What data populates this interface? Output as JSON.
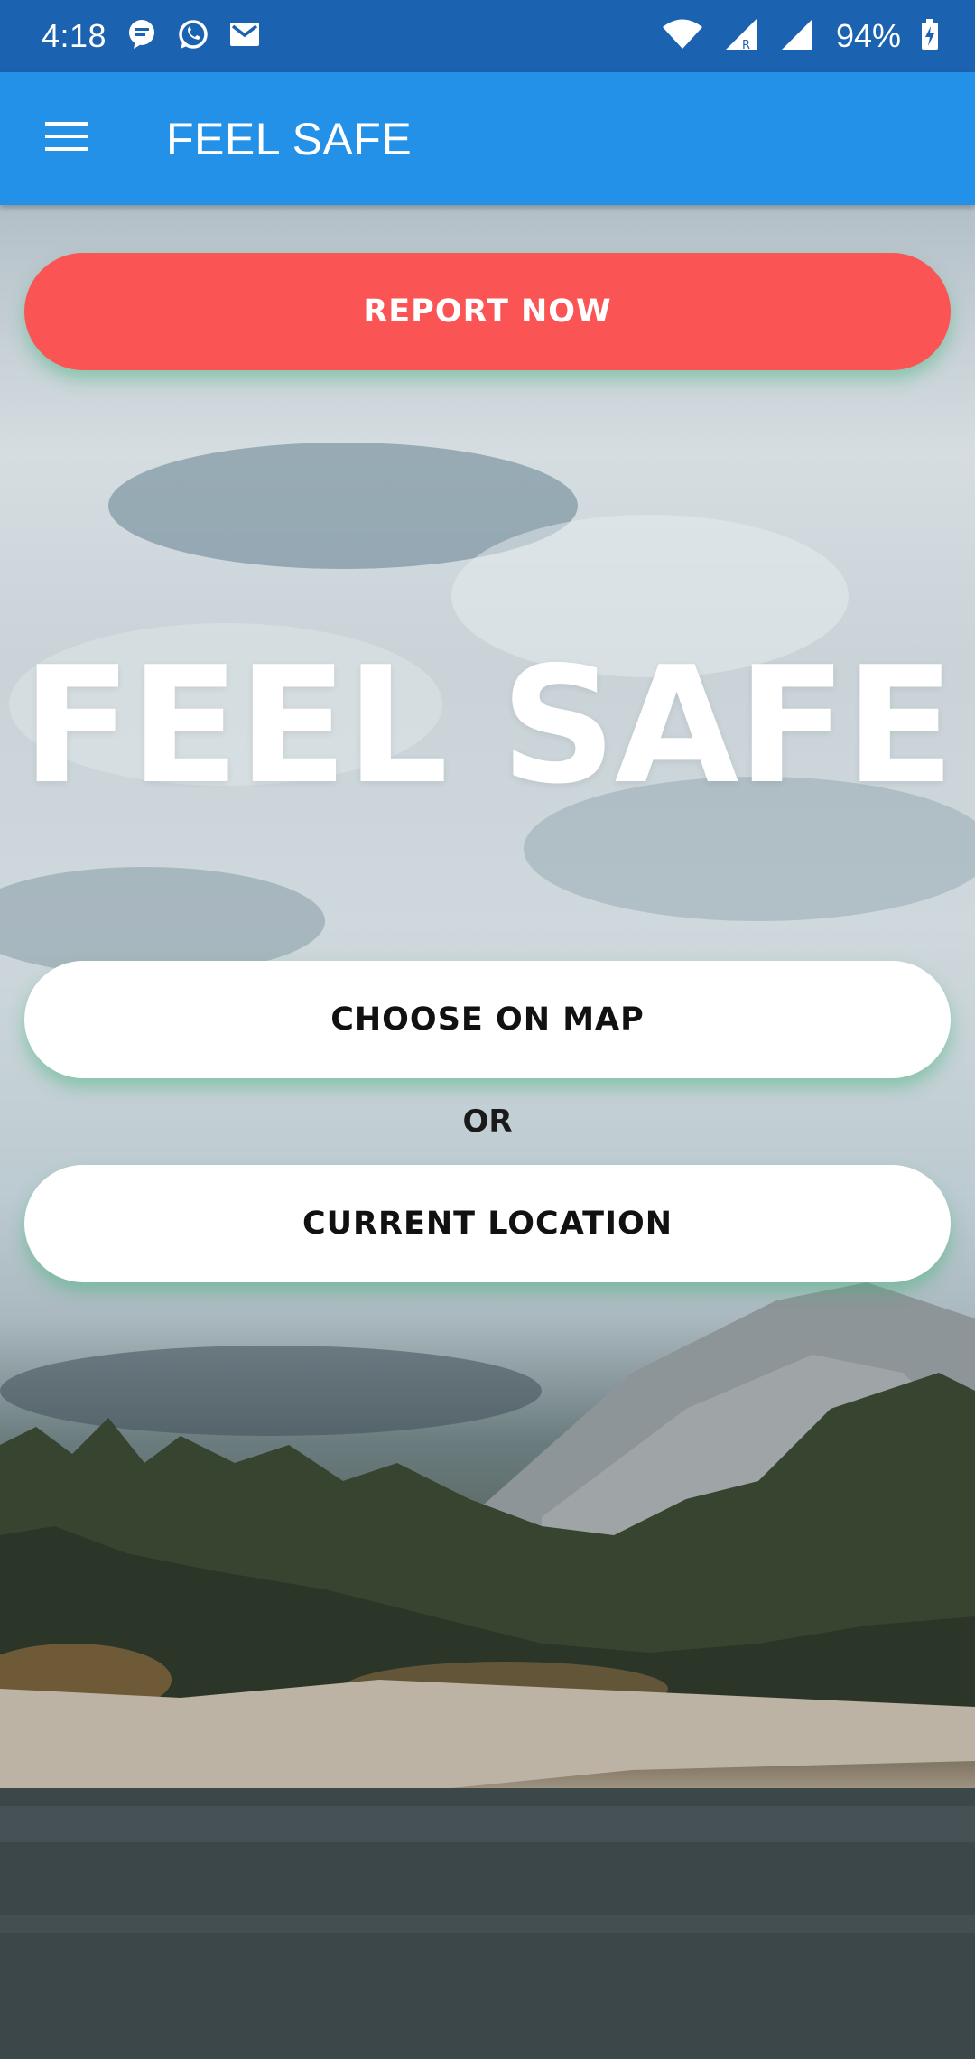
{
  "status_bar": {
    "time": "4:18",
    "notification_icons": [
      "chat-icon",
      "whatsapp-icon",
      "gmail-icon"
    ],
    "battery": "94%",
    "background_color": "#1b63b0"
  },
  "app_bar": {
    "title": "FEEL SAFE",
    "background_color": "#2491e9"
  },
  "main": {
    "report_button": "REPORT NOW",
    "report_button_color": "#fb5454",
    "hero_title": "FEEL SAFE",
    "choose_on_map_button": "CHOOSE ON MAP",
    "or_label": "OR",
    "current_location_button": "CURRENT LOCATION"
  }
}
